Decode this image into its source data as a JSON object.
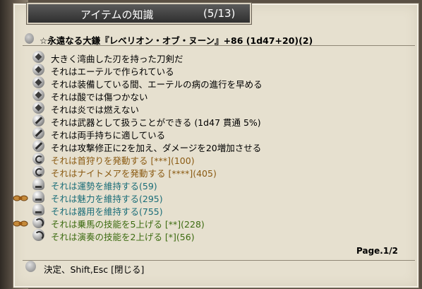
{
  "window": {
    "title": "アイテムの知識",
    "page_count": "(5/13)"
  },
  "item": {
    "name": "☆永遠なる大鎌『レベリオン・オブ・ヌーン』+86  (1d47+20)(2)"
  },
  "colors": {
    "normal": "#000000",
    "activation": "#8a5a12",
    "attribute": "#1a6d78",
    "skill": "#3c6b10"
  },
  "properties": [
    {
      "icon": "diamond-icon",
      "text": "大きく湾曲した刃を持った刀剣だ",
      "color": "black",
      "deco": false
    },
    {
      "icon": "diamond-icon",
      "text": "それはエーテルで作られている",
      "color": "black",
      "deco": false
    },
    {
      "icon": "diamond-icon",
      "text": "それは装備している間、エーテルの病の進行を早める",
      "color": "black",
      "deco": false
    },
    {
      "icon": "diamond-icon",
      "text": "それは酸では傷つかない",
      "color": "black",
      "deco": false
    },
    {
      "icon": "diamond-icon",
      "text": "それは炎では燃えない",
      "color": "black",
      "deco": false
    },
    {
      "icon": "sword-icon",
      "text": "それは武器として扱うことができる (1d47 貫通 5%)",
      "color": "black",
      "deco": false
    },
    {
      "icon": "sword-icon",
      "text": "それは両手持ちに適している",
      "color": "black",
      "deco": false
    },
    {
      "icon": "sword-icon",
      "text": "それは攻撃修正に2を加え、ダメージを20増加させる",
      "color": "black",
      "deco": false
    },
    {
      "icon": "spiral-icon",
      "text": "それは首狩りを発動する [***](100)",
      "color": "brown",
      "deco": false
    },
    {
      "icon": "spiral-icon",
      "text": "それはナイトメアを発動する [****](405)",
      "color": "brown",
      "deco": false
    },
    {
      "icon": "bell-icon",
      "text": "それは運勢を維持する(59)",
      "color": "teal",
      "deco": false
    },
    {
      "icon": "bell-icon",
      "text": "それは魅力を維持する(295)",
      "color": "teal",
      "deco": true
    },
    {
      "icon": "bell-icon",
      "text": "それは器用を維持する(755)",
      "color": "teal",
      "deco": false
    },
    {
      "icon": "swirl-icon",
      "text": "それは乗馬の技能を5上げる [**](228)",
      "color": "green",
      "deco": true
    },
    {
      "icon": "swirl-icon",
      "text": "それは演奏の技能を2上げる [*](56)",
      "color": "green",
      "deco": false
    }
  ],
  "page_label": "Page.1/2",
  "footer": {
    "hint": "決定、Shift,Esc [閉じる]"
  }
}
